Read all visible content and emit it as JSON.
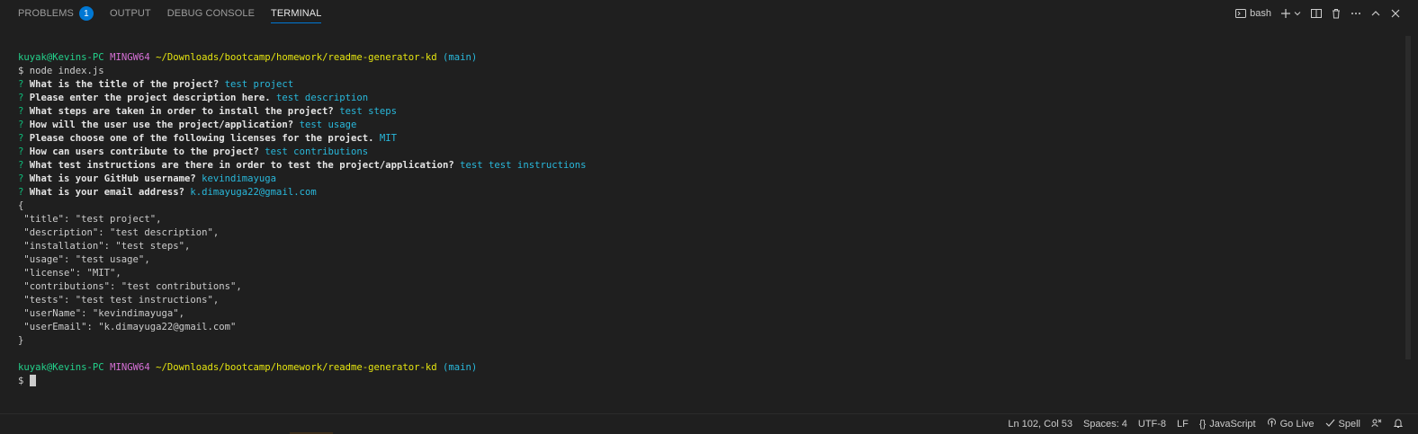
{
  "panel": {
    "tabs": [
      {
        "label": "PROBLEMS",
        "badge": "1"
      },
      {
        "label": "OUTPUT"
      },
      {
        "label": "DEBUG CONSOLE"
      },
      {
        "label": "TERMINAL",
        "active": true
      }
    ],
    "actions": {
      "shell_label": "bash"
    }
  },
  "terminal": {
    "prompt1": {
      "user": "kuyak@Kevins-PC",
      "env": "MINGW64",
      "path": "~/Downloads/bootcamp/homework/readme-generator-kd",
      "branch": "(main)"
    },
    "command": "$ node index.js",
    "questions": [
      {
        "q": "What is the title of the project?",
        "a": "test project"
      },
      {
        "q": "Please enter the project description here.",
        "a": "test description"
      },
      {
        "q": "What steps are taken in order to install the project?",
        "a": "test steps"
      },
      {
        "q": "How will the user use the project/application?",
        "a": "test usage"
      },
      {
        "q": "Please choose one of the following licenses for the project.",
        "a": "MIT"
      },
      {
        "q": "How can users contribute to the project?",
        "a": "test contributions"
      },
      {
        "q": "What test instructions are there in order to test the project/application?",
        "a": "test test instructions"
      },
      {
        "q": "What is your GitHub username?",
        "a": "kevindimayuga"
      },
      {
        "q": "What is your email address?",
        "a": "k.dimayuga22@gmail.com"
      }
    ],
    "json_open": "{",
    "json_lines": [
      " \"title\": \"test project\",",
      " \"description\": \"test description\",",
      " \"installation\": \"test steps\",",
      " \"usage\": \"test usage\",",
      " \"license\": \"MIT\",",
      " \"contributions\": \"test contributions\",",
      " \"tests\": \"test test instructions\",",
      " \"userName\": \"kevindimayuga\",",
      " \"userEmail\": \"k.dimayuga22@gmail.com\""
    ],
    "json_close": "}",
    "prompt2": {
      "user": "kuyak@Kevins-PC",
      "env": "MINGW64",
      "path": "~/Downloads/bootcamp/homework/readme-generator-kd",
      "branch": "(main)"
    },
    "final_prompt": "$ "
  },
  "statusbar": {
    "cursor_pos": "Ln 102, Col 53",
    "spaces": "Spaces: 4",
    "encoding": "UTF-8",
    "eol": "LF",
    "language_braces": "{}",
    "language": "JavaScript",
    "go_live": "Go Live",
    "spell": "Spell"
  },
  "colors": {
    "background": "#1f1f1f",
    "accent": "#0078d4",
    "prompt_user": "#23d18b",
    "prompt_env": "#d670d6",
    "prompt_path": "#e5e510",
    "prompt_branch": "#29b8db",
    "answer": "#29b8db"
  }
}
